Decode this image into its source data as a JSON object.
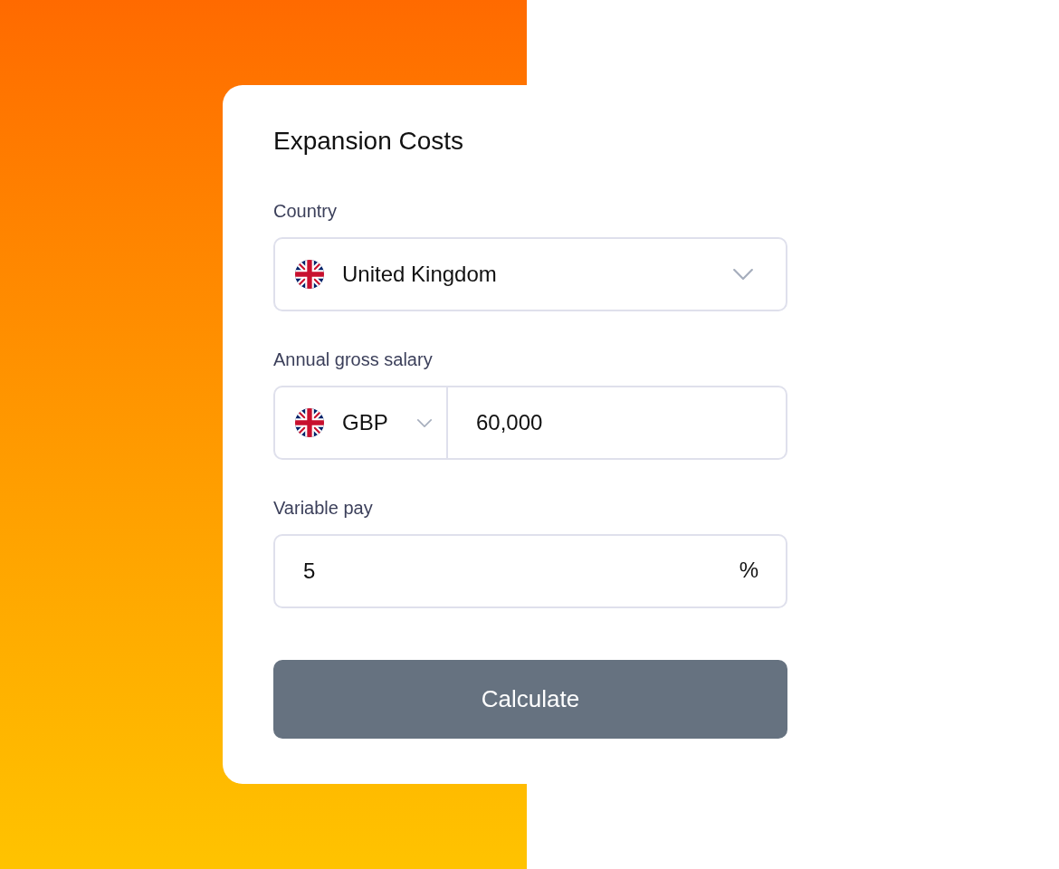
{
  "card": {
    "title": "Expansion Costs",
    "fields": [
      {
        "kind": "select",
        "label": "Country",
        "value": "United Kingdom"
      },
      {
        "kind": "currency_amount",
        "label": "Annual gross salary",
        "currency": "GBP",
        "value": "60,000"
      },
      {
        "kind": "suffix_input",
        "label": "Variable pay",
        "value": "5",
        "suffix": "%"
      }
    ],
    "button": {
      "label": "Calculate"
    }
  }
}
